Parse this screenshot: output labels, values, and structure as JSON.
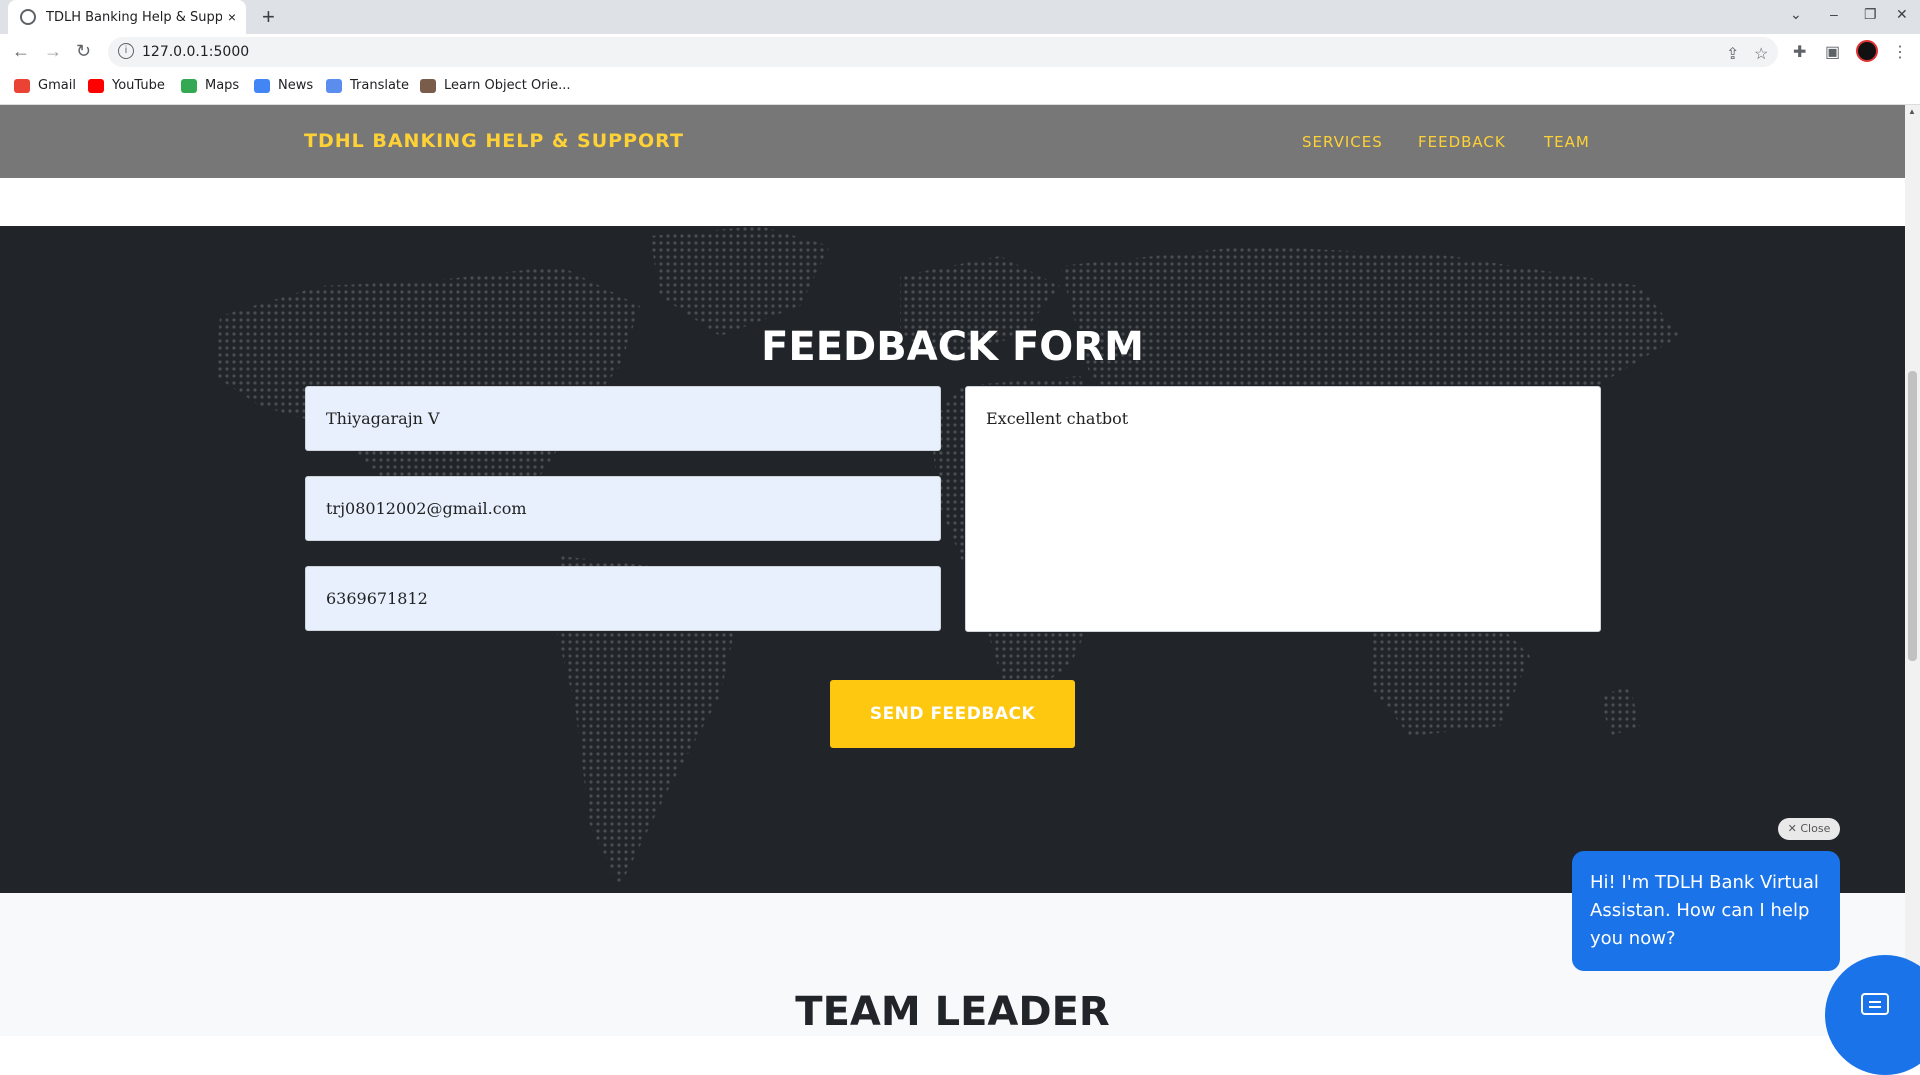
{
  "browser": {
    "tab_title": "TDLH Banking Help & Suppor",
    "tab_close": "×",
    "new_tab": "+",
    "url": "127.0.0.1:5000",
    "bookmarks": [
      "Gmail",
      "YouTube",
      "Maps",
      "News",
      "Translate",
      "Learn Object Orie..."
    ]
  },
  "site": {
    "brand": "TDHL BANKING HELP & SUPPORT",
    "nav": [
      "SERVICES",
      "FEEDBACK",
      "TEAM"
    ]
  },
  "feedback_form": {
    "title": "FEEDBACK FORM",
    "name_value": "Thiyagarajn V",
    "email_value": "trj08012002@gmail.com",
    "phone_value": "6369671812",
    "message_value": "Excellent chatbot",
    "submit_label": "SEND FEEDBACK"
  },
  "team": {
    "title": "TEAM LEADER"
  },
  "chat": {
    "close_label": "✕ Close",
    "greeting": "Hi! I'm TDLH Bank Virtual Assistan. How can I help you now?"
  },
  "colors": {
    "accent": "#fed136",
    "button": "#fec810",
    "dark_bg": "#212529",
    "chat_blue": "#1a73e8"
  }
}
